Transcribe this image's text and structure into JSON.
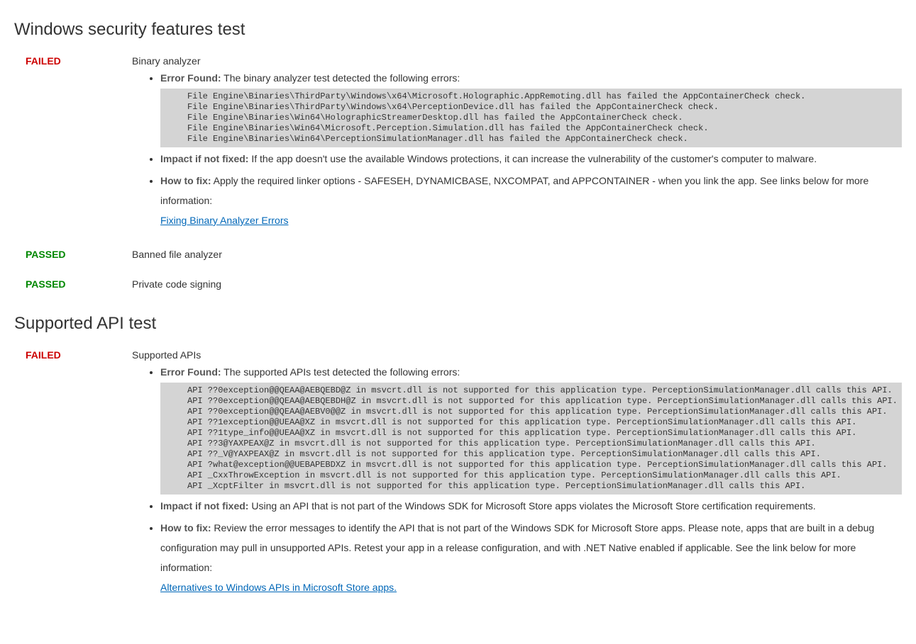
{
  "sections": [
    {
      "title": "Windows security features test",
      "results": [
        {
          "status": "FAILED",
          "status_class": "status-failed",
          "name": "Binary analyzer",
          "error_label": "Error Found:",
          "error_text": " The binary analyzer test detected the following errors:",
          "error_lines": [
            "File Engine\\Binaries\\ThirdParty\\Windows\\x64\\Microsoft.Holographic.AppRemoting.dll has failed the AppContainerCheck check.",
            "File Engine\\Binaries\\ThirdParty\\Windows\\x64\\PerceptionDevice.dll has failed the AppContainerCheck check.",
            "File Engine\\Binaries\\Win64\\HolographicStreamerDesktop.dll has failed the AppContainerCheck check.",
            "File Engine\\Binaries\\Win64\\Microsoft.Perception.Simulation.dll has failed the AppContainerCheck check.",
            "File Engine\\Binaries\\Win64\\PerceptionSimulationManager.dll has failed the AppContainerCheck check."
          ],
          "impact_label": "Impact if not fixed:",
          "impact_text": " If the app doesn't use the available Windows protections, it can increase the vulnerability of the customer's computer to malware.",
          "fix_label": "How to fix:",
          "fix_text": " Apply the required linker options - SAFESEH, DYNAMICBASE, NXCOMPAT, and APPCONTAINER - when you link the app. See links below for more information:",
          "fix_link": "Fixing Binary Analyzer Errors"
        },
        {
          "status": "PASSED",
          "status_class": "status-passed",
          "name": "Banned file analyzer"
        },
        {
          "status": "PASSED",
          "status_class": "status-passed",
          "name": "Private code signing"
        }
      ]
    },
    {
      "title": "Supported API test",
      "results": [
        {
          "status": "FAILED",
          "status_class": "status-failed",
          "name": "Supported APIs",
          "error_label": "Error Found:",
          "error_text": " The supported APIs test detected the following errors:",
          "error_lines": [
            "API ??0exception@@QEAA@AEBQEBD@Z in msvcrt.dll is not supported for this application type. PerceptionSimulationManager.dll calls this API.",
            "API ??0exception@@QEAA@AEBQEBDH@Z in msvcrt.dll is not supported for this application type. PerceptionSimulationManager.dll calls this API.",
            "API ??0exception@@QEAA@AEBV0@@Z in msvcrt.dll is not supported for this application type. PerceptionSimulationManager.dll calls this API.",
            "API ??1exception@@UEAA@XZ in msvcrt.dll is not supported for this application type. PerceptionSimulationManager.dll calls this API.",
            "API ??1type_info@@UEAA@XZ in msvcrt.dll is not supported for this application type. PerceptionSimulationManager.dll calls this API.",
            "API ??3@YAXPEAX@Z in msvcrt.dll is not supported for this application type. PerceptionSimulationManager.dll calls this API.",
            "API ??_V@YAXPEAX@Z in msvcrt.dll is not supported for this application type. PerceptionSimulationManager.dll calls this API.",
            "API ?what@exception@@UEBAPEBDXZ in msvcrt.dll is not supported for this application type. PerceptionSimulationManager.dll calls this API.",
            "API _CxxThrowException in msvcrt.dll is not supported for this application type. PerceptionSimulationManager.dll calls this API.",
            "API _XcptFilter in msvcrt.dll is not supported for this application type. PerceptionSimulationManager.dll calls this API."
          ],
          "impact_label": "Impact if not fixed:",
          "impact_text": " Using an API that is not part of the Windows SDK for Microsoft Store apps violates the Microsoft Store certification requirements.",
          "fix_label": "How to fix:",
          "fix_text": " Review the error messages to identify the API that is not part of the Windows SDK for Microsoft Store apps. Please note, apps that are built in a debug configuration may pull in unsupported APIs. Retest your app in a release configuration, and with .NET Native enabled if applicable. See the link below for more information:",
          "fix_link": "Alternatives to Windows APIs in Microsoft Store apps."
        }
      ]
    }
  ]
}
